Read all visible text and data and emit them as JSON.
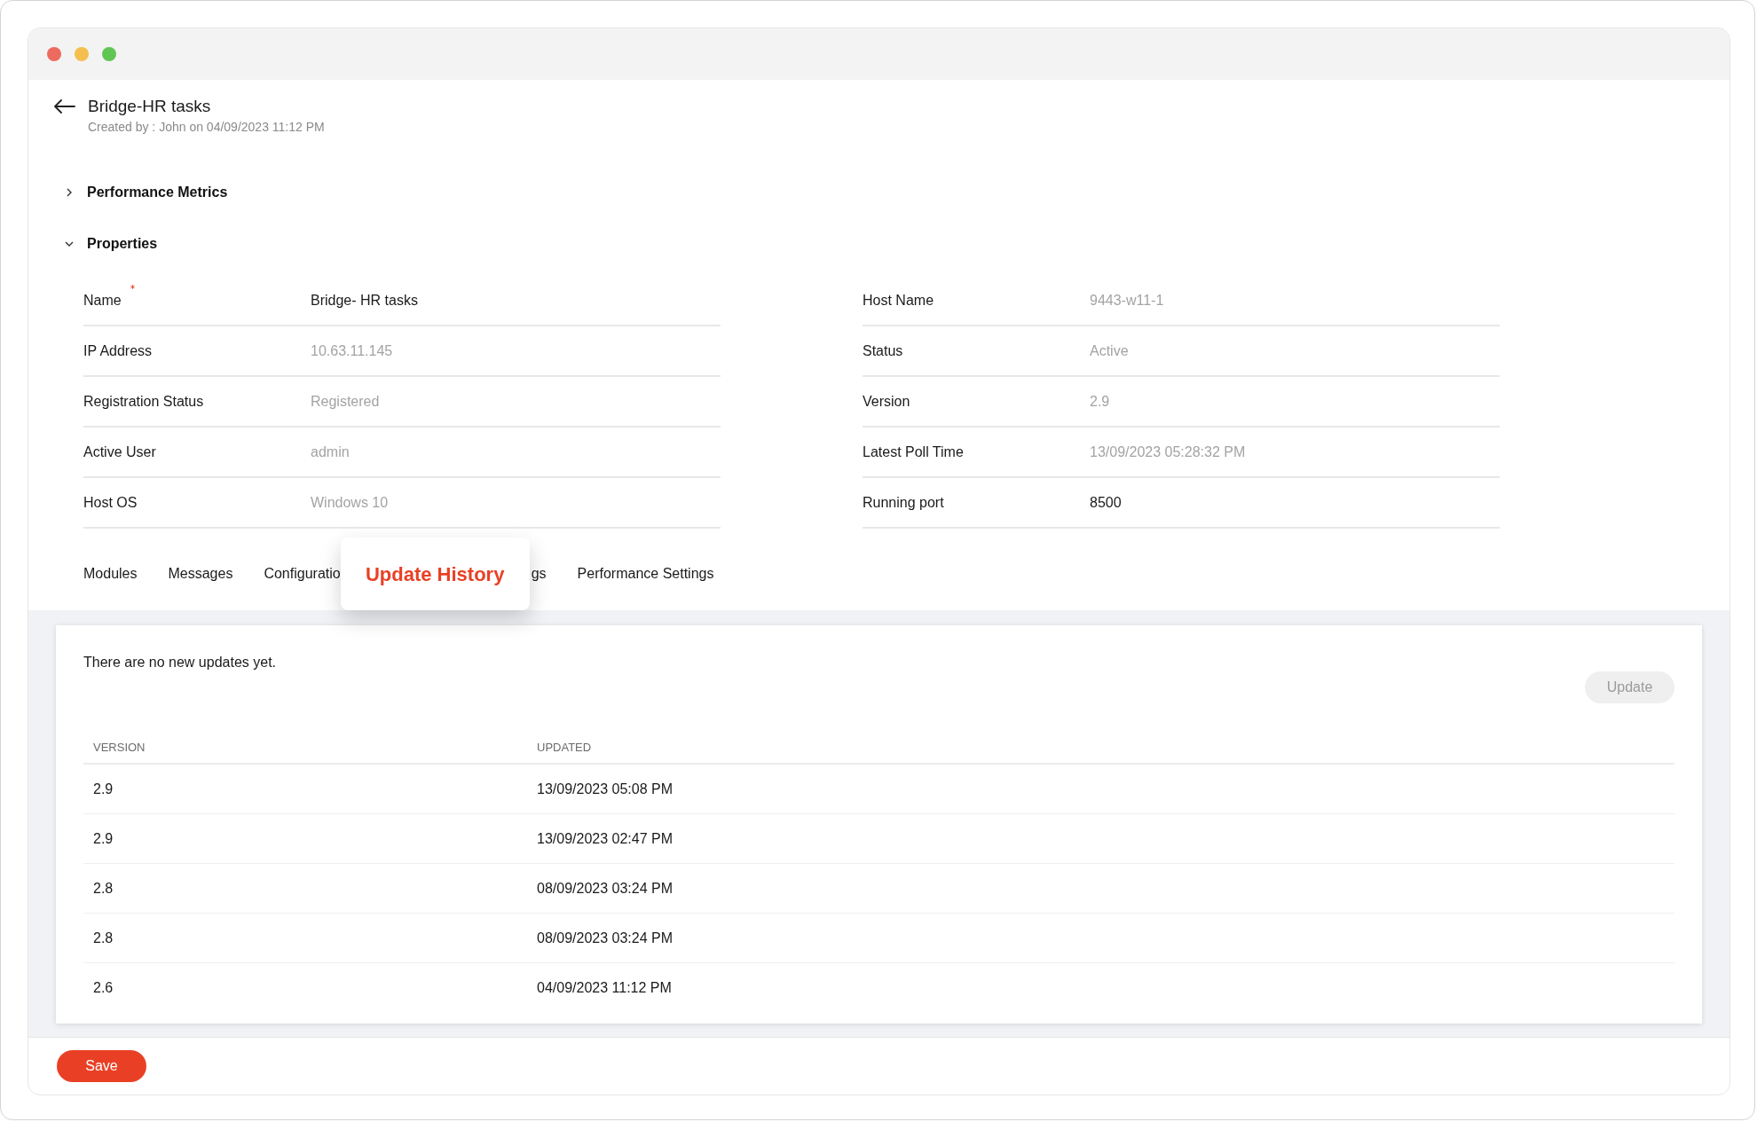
{
  "header": {
    "title": "Bridge-HR tasks",
    "subtitle": "Created by : John on 04/09/2023 11:12 PM"
  },
  "sections": [
    {
      "label": "Performance Metrics",
      "expanded": false
    },
    {
      "label": "Properties",
      "expanded": true
    }
  ],
  "properties": {
    "left": [
      {
        "label": "Name",
        "value": "Bridge- HR tasks",
        "required": true,
        "disabled": false
      },
      {
        "label": "IP Address",
        "value": "10.63.11.145",
        "required": false,
        "disabled": true
      },
      {
        "label": "Registration Status",
        "value": "Registered",
        "required": false,
        "disabled": true
      },
      {
        "label": "Active User",
        "value": "admin",
        "required": false,
        "disabled": true
      },
      {
        "label": "Host OS",
        "value": "Windows 10",
        "required": false,
        "disabled": true
      }
    ],
    "right": [
      {
        "label": "Host Name",
        "value": "9443-w11-1",
        "required": false,
        "disabled": true
      },
      {
        "label": "Status",
        "value": "Active",
        "required": false,
        "disabled": true
      },
      {
        "label": "Version",
        "value": "2.9",
        "required": false,
        "disabled": true
      },
      {
        "label": "Latest Poll Time",
        "value": "13/09/2023 05:28:32 PM",
        "required": false,
        "disabled": true
      },
      {
        "label": "Running port",
        "value": "8500",
        "required": false,
        "disabled": false
      }
    ]
  },
  "tabs": [
    {
      "label": "Modules",
      "selected": false
    },
    {
      "label": "Messages",
      "selected": false
    },
    {
      "label": "Configuratio",
      "selected": false
    },
    {
      "label": "gs",
      "selected": false
    },
    {
      "label": "Performance Settings",
      "selected": false
    }
  ],
  "highlight_callout": {
    "label": "Update History"
  },
  "panel": {
    "message": "There are no new updates yet.",
    "update_button": {
      "label": "Update",
      "disabled": true
    },
    "table": {
      "columns": [
        "VERSION",
        "UPDATED"
      ],
      "rows": [
        [
          "2.9",
          "13/09/2023 05:08 PM"
        ],
        [
          "2.9",
          "13/09/2023 02:47 PM"
        ],
        [
          "2.8",
          "08/09/2023 03:24 PM"
        ],
        [
          "2.8",
          "08/09/2023 03:24 PM"
        ],
        [
          "2.6",
          "04/09/2023 11:12 PM"
        ]
      ]
    }
  },
  "footer": {
    "save_button": "Save"
  }
}
